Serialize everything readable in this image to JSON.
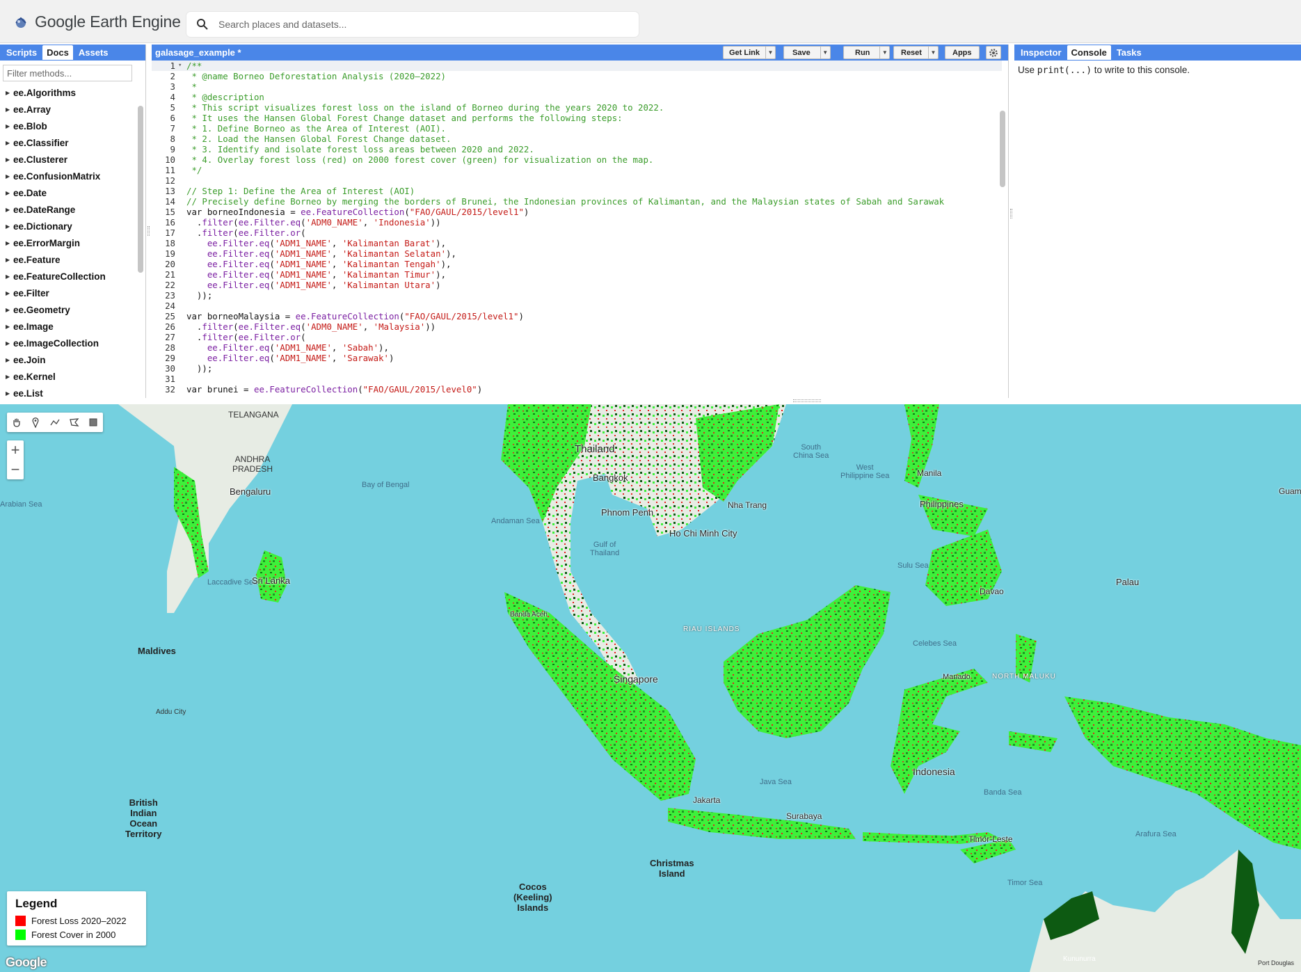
{
  "app": {
    "title": "Google Earth Engine",
    "search_placeholder": "Search places and datasets..."
  },
  "left_panel": {
    "tabs": [
      {
        "label": "Scripts",
        "active": false
      },
      {
        "label": "Docs",
        "active": true
      },
      {
        "label": "Assets",
        "active": false
      }
    ],
    "filter_placeholder": "Filter methods...",
    "items": [
      "ee.Algorithms",
      "ee.Array",
      "ee.Blob",
      "ee.Classifier",
      "ee.Clusterer",
      "ee.ConfusionMatrix",
      "ee.Date",
      "ee.DateRange",
      "ee.Dictionary",
      "ee.ErrorMargin",
      "ee.Feature",
      "ee.FeatureCollection",
      "ee.Filter",
      "ee.Geometry",
      "ee.Image",
      "ee.ImageCollection",
      "ee.Join",
      "ee.Kernel",
      "ee.List"
    ]
  },
  "editor": {
    "file_name": "galasage_example *",
    "buttons": {
      "get_link": "Get Link",
      "save": "Save",
      "run": "Run",
      "reset": "Reset",
      "apps": "Apps"
    },
    "lines": [
      {
        "n": "1",
        "parts": [
          [
            "c-com",
            "/**"
          ]
        ]
      },
      {
        "n": "2",
        "parts": [
          [
            "c-com",
            " * @name Borneo Deforestation Analysis (2020–2022)"
          ]
        ]
      },
      {
        "n": "3",
        "parts": [
          [
            "c-com",
            " *"
          ]
        ]
      },
      {
        "n": "4",
        "parts": [
          [
            "c-com",
            " * @description"
          ]
        ]
      },
      {
        "n": "5",
        "parts": [
          [
            "c-com",
            " * This script visualizes forest loss on the island of Borneo during the years 2020 to 2022."
          ]
        ]
      },
      {
        "n": "6",
        "parts": [
          [
            "c-com",
            " * It uses the Hansen Global Forest Change dataset and performs the following steps:"
          ]
        ]
      },
      {
        "n": "7",
        "parts": [
          [
            "c-com",
            " * 1. Define Borneo as the Area of Interest (AOI)."
          ]
        ]
      },
      {
        "n": "8",
        "parts": [
          [
            "c-com",
            " * 2. Load the Hansen Global Forest Change dataset."
          ]
        ]
      },
      {
        "n": "9",
        "parts": [
          [
            "c-com",
            " * 3. Identify and isolate forest loss areas between 2020 and 2022."
          ]
        ]
      },
      {
        "n": "10",
        "parts": [
          [
            "c-com",
            " * 4. Overlay forest loss (red) on 2000 forest cover (green) for visualization on the map."
          ]
        ]
      },
      {
        "n": "11",
        "parts": [
          [
            "c-com",
            " */"
          ]
        ]
      },
      {
        "n": "12",
        "parts": [
          [
            "code",
            ""
          ]
        ]
      },
      {
        "n": "13",
        "parts": [
          [
            "c-com",
            "// Step 1: Define the Area of Interest (AOI)"
          ]
        ]
      },
      {
        "n": "14",
        "parts": [
          [
            "c-com",
            "// Precisely define Borneo by merging the borders of Brunei, the Indonesian provinces of Kalimantan, and the Malaysian states of Sabah and Sarawak"
          ]
        ]
      },
      {
        "n": "15",
        "parts": [
          [
            "c-kw",
            "var "
          ],
          [
            "code",
            "borneoIndonesia = "
          ],
          [
            "c-fn",
            "ee.FeatureCollection"
          ],
          [
            "code",
            "("
          ],
          [
            "c-str",
            "\"FAO/GAUL/2015/level1\""
          ],
          [
            "code",
            ")"
          ]
        ]
      },
      {
        "n": "16",
        "parts": [
          [
            "code",
            "  ."
          ],
          [
            "c-fn",
            "filter"
          ],
          [
            "code",
            "("
          ],
          [
            "c-fn",
            "ee.Filter.eq"
          ],
          [
            "code",
            "("
          ],
          [
            "c-str",
            "'ADM0_NAME'"
          ],
          [
            "code",
            ", "
          ],
          [
            "c-str",
            "'Indonesia'"
          ],
          [
            "code",
            "))"
          ]
        ]
      },
      {
        "n": "17",
        "parts": [
          [
            "code",
            "  ."
          ],
          [
            "c-fn",
            "filter"
          ],
          [
            "code",
            "("
          ],
          [
            "c-fn",
            "ee.Filter.or"
          ],
          [
            "code",
            "("
          ]
        ]
      },
      {
        "n": "18",
        "parts": [
          [
            "code",
            "    "
          ],
          [
            "c-fn",
            "ee.Filter.eq"
          ],
          [
            "code",
            "("
          ],
          [
            "c-str",
            "'ADM1_NAME'"
          ],
          [
            "code",
            ", "
          ],
          [
            "c-str",
            "'Kalimantan Barat'"
          ],
          [
            "code",
            "),"
          ]
        ]
      },
      {
        "n": "19",
        "parts": [
          [
            "code",
            "    "
          ],
          [
            "c-fn",
            "ee.Filter.eq"
          ],
          [
            "code",
            "("
          ],
          [
            "c-str",
            "'ADM1_NAME'"
          ],
          [
            "code",
            ", "
          ],
          [
            "c-str",
            "'Kalimantan Selatan'"
          ],
          [
            "code",
            "),"
          ]
        ]
      },
      {
        "n": "20",
        "parts": [
          [
            "code",
            "    "
          ],
          [
            "c-fn",
            "ee.Filter.eq"
          ],
          [
            "code",
            "("
          ],
          [
            "c-str",
            "'ADM1_NAME'"
          ],
          [
            "code",
            ", "
          ],
          [
            "c-str",
            "'Kalimantan Tengah'"
          ],
          [
            "code",
            "),"
          ]
        ]
      },
      {
        "n": "21",
        "parts": [
          [
            "code",
            "    "
          ],
          [
            "c-fn",
            "ee.Filter.eq"
          ],
          [
            "code",
            "("
          ],
          [
            "c-str",
            "'ADM1_NAME'"
          ],
          [
            "code",
            ", "
          ],
          [
            "c-str",
            "'Kalimantan Timur'"
          ],
          [
            "code",
            "),"
          ]
        ]
      },
      {
        "n": "22",
        "parts": [
          [
            "code",
            "    "
          ],
          [
            "c-fn",
            "ee.Filter.eq"
          ],
          [
            "code",
            "("
          ],
          [
            "c-str",
            "'ADM1_NAME'"
          ],
          [
            "code",
            ", "
          ],
          [
            "c-str",
            "'Kalimantan Utara'"
          ],
          [
            "code",
            ")"
          ]
        ]
      },
      {
        "n": "23",
        "parts": [
          [
            "code",
            "  ));"
          ]
        ]
      },
      {
        "n": "24",
        "parts": [
          [
            "code",
            ""
          ]
        ]
      },
      {
        "n": "25",
        "parts": [
          [
            "c-kw",
            "var "
          ],
          [
            "code",
            "borneoMalaysia = "
          ],
          [
            "c-fn",
            "ee.FeatureCollection"
          ],
          [
            "code",
            "("
          ],
          [
            "c-str",
            "\"FAO/GAUL/2015/level1\""
          ],
          [
            "code",
            ")"
          ]
        ]
      },
      {
        "n": "26",
        "parts": [
          [
            "code",
            "  ."
          ],
          [
            "c-fn",
            "filter"
          ],
          [
            "code",
            "("
          ],
          [
            "c-fn",
            "ee.Filter.eq"
          ],
          [
            "code",
            "("
          ],
          [
            "c-str",
            "'ADM0_NAME'"
          ],
          [
            "code",
            ", "
          ],
          [
            "c-str",
            "'Malaysia'"
          ],
          [
            "code",
            "))"
          ]
        ]
      },
      {
        "n": "27",
        "parts": [
          [
            "code",
            "  ."
          ],
          [
            "c-fn",
            "filter"
          ],
          [
            "code",
            "("
          ],
          [
            "c-fn",
            "ee.Filter.or"
          ],
          [
            "code",
            "("
          ]
        ]
      },
      {
        "n": "28",
        "parts": [
          [
            "code",
            "    "
          ],
          [
            "c-fn",
            "ee.Filter.eq"
          ],
          [
            "code",
            "("
          ],
          [
            "c-str",
            "'ADM1_NAME'"
          ],
          [
            "code",
            ", "
          ],
          [
            "c-str",
            "'Sabah'"
          ],
          [
            "code",
            "),"
          ]
        ]
      },
      {
        "n": "29",
        "parts": [
          [
            "code",
            "    "
          ],
          [
            "c-fn",
            "ee.Filter.eq"
          ],
          [
            "code",
            "("
          ],
          [
            "c-str",
            "'ADM1_NAME'"
          ],
          [
            "code",
            ", "
          ],
          [
            "c-str",
            "'Sarawak'"
          ],
          [
            "code",
            ")"
          ]
        ]
      },
      {
        "n": "30",
        "parts": [
          [
            "code",
            "  ));"
          ]
        ]
      },
      {
        "n": "31",
        "parts": [
          [
            "code",
            ""
          ]
        ]
      },
      {
        "n": "32",
        "parts": [
          [
            "c-kw",
            "var "
          ],
          [
            "code",
            "brunei = "
          ],
          [
            "c-fn",
            "ee.FeatureCollection"
          ],
          [
            "code",
            "("
          ],
          [
            "c-str",
            "\"FAO/GAUL/2015/level0\""
          ],
          [
            "code",
            ")"
          ]
        ]
      }
    ]
  },
  "right_panel": {
    "tabs": [
      {
        "label": "Inspector",
        "active": false
      },
      {
        "label": "Console",
        "active": true
      },
      {
        "label": "Tasks",
        "active": false
      }
    ],
    "console_prefix": "Use ",
    "console_code": "print(...)",
    "console_suffix": " to write to this console."
  },
  "map": {
    "labels": {
      "telangana": "TELANGANA",
      "andhra": "ANDHRA\nPRADESH",
      "arabian_sea": "Arabian Sea",
      "bay_of_bengal": "Bay of Bengal",
      "bengaluru": "Bengaluru",
      "laccadive_sea": "Laccadive Sea",
      "sri_lanka": "Sri Lanka",
      "maldives": "Maldives",
      "addu_city": "Addu City",
      "biot": "British\nIndian\nOcean\nTerritory",
      "thailand": "Thailand",
      "bangkok": "Bangkok",
      "andaman_sea": "Andaman Sea",
      "gulf_thailand": "Gulf of\nThailand",
      "phnom_penh": "Phnom Penh",
      "nha_trang": "Nha Trang",
      "hcmc": "Ho Chi Minh City",
      "south_china_sea": "South\nChina Sea",
      "west_ph_sea": "West\nPhilippine Sea",
      "manila": "Manila",
      "philippines": "Philippines",
      "sulu_sea": "Sulu Sea",
      "davao": "Davao",
      "palau": "Palau",
      "banda_aceh": "Banda Aceh",
      "riau": "RIAU ISLANDS",
      "singapore": "Singapore",
      "celebes_sea": "Celebes Sea",
      "manado": "Manado",
      "north_maluku": "NORTH MALUKU",
      "java_sea": "Java Sea",
      "indonesia": "Indonesia",
      "banda_sea": "Banda Sea",
      "jakarta": "Jakarta",
      "surabaya": "Surabaya",
      "timor_leste": "Timor-Leste",
      "arafura_sea": "Arafura Sea",
      "timor_sea": "Timor Sea",
      "christmas": "Christmas\nIsland",
      "cocos": "Cocos\n(Keeling)\nIslands",
      "kununurra": "Kununurra",
      "guam": "Guam",
      "port_douglas": "Port Douglas"
    },
    "legend": {
      "title": "Legend",
      "entries": [
        {
          "label": "Forest Loss 2020–2022",
          "color": "#ff0000"
        },
        {
          "label": "Forest Cover in 2000",
          "color": "#00ff00"
        }
      ]
    },
    "google": "Google",
    "colors": {
      "sea": "#74d0df",
      "forest": "#3ef03a",
      "dark_forest": "#0d5a12",
      "loss": "#ff2020",
      "land": "#e7ece4"
    }
  }
}
